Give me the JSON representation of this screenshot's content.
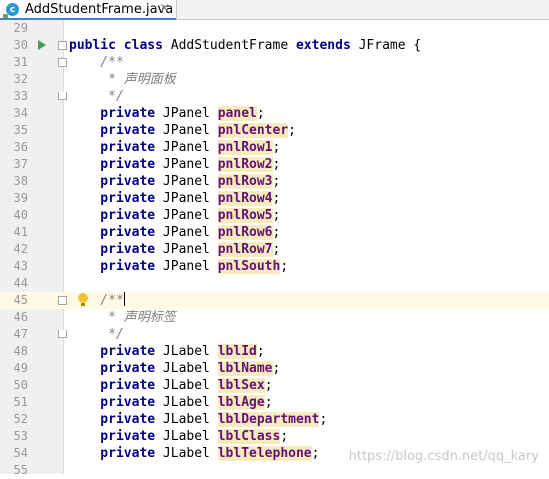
{
  "tab": {
    "filename": "AddStudentFrame.java",
    "close_glyph": "×",
    "icon_letter": "c"
  },
  "lines": [
    {
      "num": "29",
      "tokens": []
    },
    {
      "num": "30",
      "tokens": [
        {
          "t": "public class ",
          "c": "kw"
        },
        {
          "t": "AddStudentFrame ",
          "c": "plain"
        },
        {
          "t": "extends ",
          "c": "kw"
        },
        {
          "t": "JFrame {",
          "c": "plain"
        }
      ]
    },
    {
      "num": "31",
      "tokens": [
        {
          "t": "    /**",
          "c": "cm"
        }
      ]
    },
    {
      "num": "32",
      "tokens": [
        {
          "t": "     * 声明面板",
          "c": "cm"
        }
      ]
    },
    {
      "num": "33",
      "tokens": [
        {
          "t": "     */",
          "c": "cm"
        }
      ]
    },
    {
      "num": "34",
      "tokens": [
        {
          "t": "    private ",
          "c": "kw"
        },
        {
          "t": "JPanel ",
          "c": "plain"
        },
        {
          "t": "panel",
          "c": "fld"
        },
        {
          "t": ";",
          "c": "plain"
        }
      ]
    },
    {
      "num": "35",
      "tokens": [
        {
          "t": "    private ",
          "c": "kw"
        },
        {
          "t": "JPanel ",
          "c": "plain"
        },
        {
          "t": "pnlCenter",
          "c": "fld"
        },
        {
          "t": ";",
          "c": "plain"
        }
      ]
    },
    {
      "num": "36",
      "tokens": [
        {
          "t": "    private ",
          "c": "kw"
        },
        {
          "t": "JPanel ",
          "c": "plain"
        },
        {
          "t": "pnlRow1",
          "c": "fld"
        },
        {
          "t": ";",
          "c": "plain"
        }
      ]
    },
    {
      "num": "37",
      "tokens": [
        {
          "t": "    private ",
          "c": "kw"
        },
        {
          "t": "JPanel ",
          "c": "plain"
        },
        {
          "t": "pnlRow2",
          "c": "fld"
        },
        {
          "t": ";",
          "c": "plain"
        }
      ]
    },
    {
      "num": "38",
      "tokens": [
        {
          "t": "    private ",
          "c": "kw"
        },
        {
          "t": "JPanel ",
          "c": "plain"
        },
        {
          "t": "pnlRow3",
          "c": "fld"
        },
        {
          "t": ";",
          "c": "plain"
        }
      ]
    },
    {
      "num": "39",
      "tokens": [
        {
          "t": "    private ",
          "c": "kw"
        },
        {
          "t": "JPanel ",
          "c": "plain"
        },
        {
          "t": "pnlRow4",
          "c": "fld"
        },
        {
          "t": ";",
          "c": "plain"
        }
      ]
    },
    {
      "num": "40",
      "tokens": [
        {
          "t": "    private ",
          "c": "kw"
        },
        {
          "t": "JPanel ",
          "c": "plain"
        },
        {
          "t": "pnlRow5",
          "c": "fld"
        },
        {
          "t": ";",
          "c": "plain"
        }
      ]
    },
    {
      "num": "41",
      "tokens": [
        {
          "t": "    private ",
          "c": "kw"
        },
        {
          "t": "JPanel ",
          "c": "plain"
        },
        {
          "t": "pnlRow6",
          "c": "fld"
        },
        {
          "t": ";",
          "c": "plain"
        }
      ]
    },
    {
      "num": "42",
      "tokens": [
        {
          "t": "    private ",
          "c": "kw"
        },
        {
          "t": "JPanel ",
          "c": "plain"
        },
        {
          "t": "pnlRow7",
          "c": "fld"
        },
        {
          "t": ";",
          "c": "plain"
        }
      ]
    },
    {
      "num": "43",
      "tokens": [
        {
          "t": "    private ",
          "c": "kw"
        },
        {
          "t": "JPanel ",
          "c": "plain"
        },
        {
          "t": "pnlSouth",
          "c": "fld"
        },
        {
          "t": ";",
          "c": "plain"
        }
      ]
    },
    {
      "num": "44",
      "tokens": []
    },
    {
      "num": "45",
      "tokens": [
        {
          "t": "    /**",
          "c": "cm"
        }
      ]
    },
    {
      "num": "46",
      "tokens": [
        {
          "t": "     * 声明标签",
          "c": "cm"
        }
      ]
    },
    {
      "num": "47",
      "tokens": [
        {
          "t": "     */",
          "c": "cm"
        }
      ]
    },
    {
      "num": "48",
      "tokens": [
        {
          "t": "    private ",
          "c": "kw"
        },
        {
          "t": "JLabel ",
          "c": "plain"
        },
        {
          "t": "lblId",
          "c": "fld"
        },
        {
          "t": ";",
          "c": "plain"
        }
      ]
    },
    {
      "num": "49",
      "tokens": [
        {
          "t": "    private ",
          "c": "kw"
        },
        {
          "t": "JLabel ",
          "c": "plain"
        },
        {
          "t": "lblName",
          "c": "fld"
        },
        {
          "t": ";",
          "c": "plain"
        }
      ]
    },
    {
      "num": "50",
      "tokens": [
        {
          "t": "    private ",
          "c": "kw"
        },
        {
          "t": "JLabel ",
          "c": "plain"
        },
        {
          "t": "lblSex",
          "c": "fld"
        },
        {
          "t": ";",
          "c": "plain"
        }
      ]
    },
    {
      "num": "51",
      "tokens": [
        {
          "t": "    private ",
          "c": "kw"
        },
        {
          "t": "JLabel ",
          "c": "plain"
        },
        {
          "t": "lblAge",
          "c": "fld"
        },
        {
          "t": ";",
          "c": "plain"
        }
      ]
    },
    {
      "num": "52",
      "tokens": [
        {
          "t": "    private ",
          "c": "kw"
        },
        {
          "t": "JLabel ",
          "c": "plain"
        },
        {
          "t": "lblDepartment",
          "c": "fld"
        },
        {
          "t": ";",
          "c": "plain"
        }
      ]
    },
    {
      "num": "53",
      "tokens": [
        {
          "t": "    private ",
          "c": "kw"
        },
        {
          "t": "JLabel ",
          "c": "plain"
        },
        {
          "t": "lblClass",
          "c": "fld"
        },
        {
          "t": ";",
          "c": "plain"
        }
      ]
    },
    {
      "num": "54",
      "tokens": [
        {
          "t": "    private ",
          "c": "kw"
        },
        {
          "t": "JLabel ",
          "c": "plain"
        },
        {
          "t": "lblTelephone",
          "c": "fld"
        },
        {
          "t": ";",
          "c": "plain"
        }
      ]
    },
    {
      "num": "55",
      "tokens": []
    }
  ],
  "watermark": "https://blog.csdn.net/qq_kary",
  "colors": {
    "keyword": "#000080",
    "comment": "#808080",
    "field": "#660e7a",
    "field_bg": "#f6ebbc",
    "current_line": "#fffae3",
    "tab_accent": "#4083c9"
  }
}
